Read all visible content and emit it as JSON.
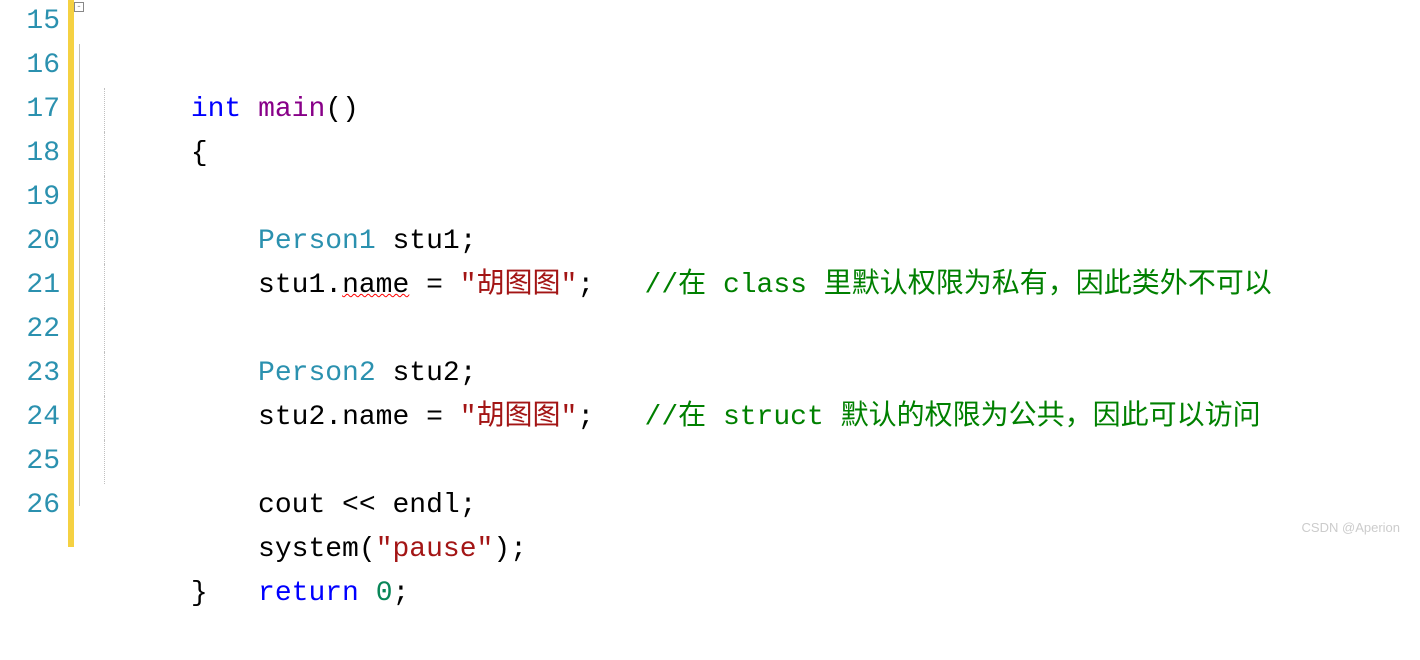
{
  "line_numbers": [
    "15",
    "16",
    "17",
    "18",
    "19",
    "20",
    "21",
    "22",
    "23",
    "24",
    "25",
    "26"
  ],
  "fold_marker": "-",
  "code": {
    "l15": {
      "kw_int": "int",
      "fn_main": "main",
      "paren": "()"
    },
    "l16": {
      "brace": "{"
    },
    "l17": {
      "type": "Person1",
      "var": " stu1",
      "semi": ";"
    },
    "l18": {
      "obj": "stu1.",
      "member": "name",
      "assign": " = ",
      "str": "\"胡图图\"",
      "semi": ";",
      "comment": "//在 class 里默认权限为私有，因此类外不可以"
    },
    "l19": {
      "blank": ""
    },
    "l20": {
      "type": "Person2",
      "var": " stu2",
      "semi": ";"
    },
    "l21": {
      "obj": "stu2.",
      "member": "name",
      "assign": " = ",
      "str": "\"胡图图\"",
      "semi": ";",
      "comment": "//在 struct 默认的权限为公共，因此可以访问"
    },
    "l22": {
      "blank": ""
    },
    "l23": {
      "cout": "cout << endl;"
    },
    "l24": {
      "sys": "system",
      "paren_open": "(",
      "str": "\"pause\"",
      "paren_close": ")",
      "semi": ";"
    },
    "l25": {
      "ret": "return",
      "sp": " ",
      "zero": "0",
      "semi": ";"
    },
    "l26": {
      "brace": "}"
    }
  },
  "watermark": "CSDN @Aperion"
}
